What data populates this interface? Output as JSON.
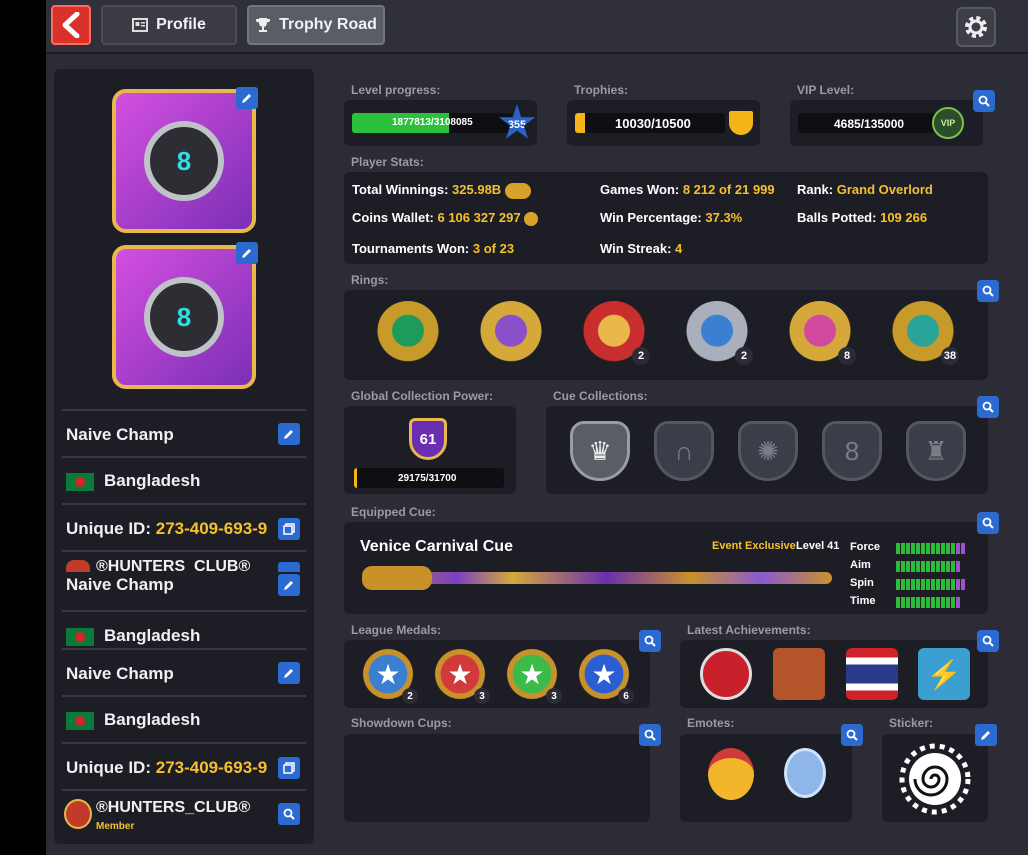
{
  "nav": {
    "profile_label": "Profile",
    "trophy_label": "Trophy Road"
  },
  "left": {
    "entries": [
      {
        "name": "Naive Champ",
        "country": "Bangladesh",
        "uid_label": "Unique ID:",
        "uid": "273-409-693-9",
        "club": "®HUNTERS_CLUB®"
      },
      {
        "name": "Naive Champ",
        "country": "Bangladesh"
      },
      {
        "name": "Naive Champ",
        "country": "Bangladesh",
        "uid_label": "Unique ID:",
        "uid": "273-409-693-9",
        "club": "®HUNTERS_CLUB®",
        "club_role": "Member"
      }
    ]
  },
  "level": {
    "label": "Level progress:",
    "progress_text": "1877813/3108085",
    "progress_fraction": 0.604,
    "level": "355"
  },
  "trophies": {
    "label": "Trophies:",
    "value": "10030/10500",
    "fraction": 0.955
  },
  "vip": {
    "label": "VIP Level:",
    "value": "4685/135000",
    "badge": "VIP"
  },
  "stats": {
    "label": "Player Stats:",
    "total_winnings_label": "Total Winnings:",
    "total_winnings": "325.98B",
    "coins_wallet_label": "Coins Wallet:",
    "coins_wallet": "6 106 327 297",
    "tournaments_label": "Tournaments Won:",
    "tournaments": "3 of 23",
    "games_won_label": "Games Won:",
    "games_won": "8 212 of 21 999",
    "win_pct_label": "Win Percentage:",
    "win_pct": "37.3%",
    "win_streak_label": "Win Streak:",
    "win_streak": "4",
    "rank_label": "Rank:",
    "rank": "Grand Overlord",
    "balls_label": "Balls Potted:",
    "balls": "109 266"
  },
  "rings": {
    "label": "Rings:",
    "items": [
      {
        "count": "",
        "color": "#c79a2a",
        "accent": "#1c9b5a"
      },
      {
        "count": "",
        "color": "#d4a93a",
        "accent": "#8a4fc8"
      },
      {
        "count": "2",
        "color": "#c92e2e",
        "accent": "#e8b84a"
      },
      {
        "count": "2",
        "color": "#a9b0bb",
        "accent": "#3b7fd1"
      },
      {
        "count": "8",
        "color": "#d4a93a",
        "accent": "#d14aa0"
      },
      {
        "count": "38",
        "color": "#c79a2a",
        "accent": "#2aa39a"
      }
    ]
  },
  "collection": {
    "label": "Global Collection Power:",
    "power": "61",
    "progress_text": "29175/31700",
    "progress_fraction": 0.02
  },
  "cue_collections": {
    "label": "Cue Collections:",
    "icons": [
      "♛",
      "∩",
      "✺",
      "8",
      "♜"
    ]
  },
  "equipped": {
    "label": "Equipped Cue:",
    "name": "Venice Carnival Cue",
    "tag": "Event Exclusive",
    "level": "Level 41",
    "stats": [
      {
        "name": "Force",
        "green": 12,
        "purple": 2
      },
      {
        "name": "Aim",
        "green": 12,
        "purple": 1
      },
      {
        "name": "Spin",
        "green": 12,
        "purple": 2
      },
      {
        "name": "Time",
        "green": 12,
        "purple": 1
      }
    ]
  },
  "league": {
    "label": "League Medals:",
    "medals": [
      {
        "count": "2",
        "color": "#3b7fd1"
      },
      {
        "count": "3",
        "color": "#d13a3a"
      },
      {
        "count": "3",
        "color": "#3dbb4a"
      },
      {
        "count": "6",
        "color": "#2b5fd1"
      }
    ]
  },
  "achievements": {
    "label": "Latest Achievements:"
  },
  "showdown": {
    "label": "Showdown Cups:"
  },
  "emotes": {
    "label": "Emotes:"
  },
  "sticker": {
    "label": "Sticker:"
  },
  "colors": {
    "gold": "#f6c02c",
    "accent_blue": "#2b6bd1",
    "bg": "#2b2c35",
    "panel": "#1d1e25"
  }
}
